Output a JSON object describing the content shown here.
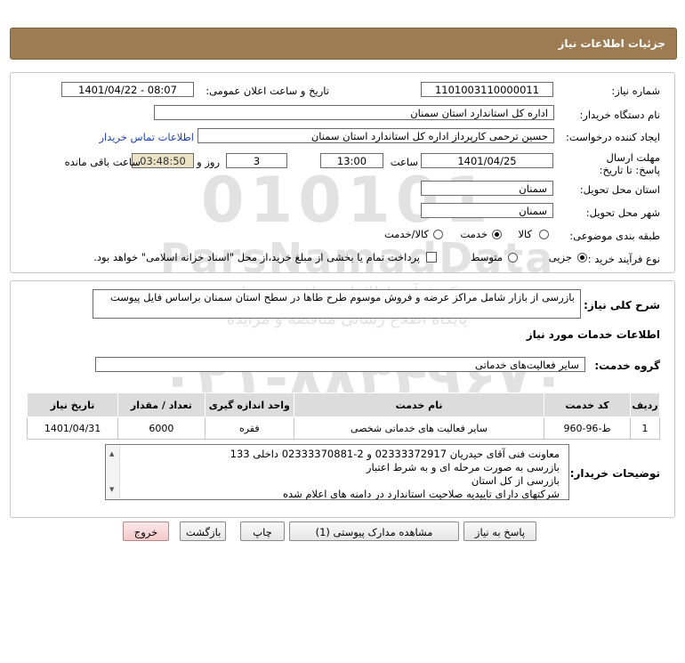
{
  "header": {
    "title": "جزئیات اطلاعات نیاز"
  },
  "watermark": {
    "line1": "010101",
    "line2": "ParsNamadData",
    "line3": "۰۲۱-۸۸۳۴۹۶۷۰",
    "sub1": "مرکز فرآیند اطلاعات مناقصه و مزایده",
    "sub2": "پایگاه اطلاع رسانی مناقصه و مزایده"
  },
  "form": {
    "need_number_label": "شماره نیاز:",
    "need_number": "1101003110000011",
    "announce_label": "تاریخ و ساعت اعلان عمومی:",
    "announce_value": "1401/04/22 - 08:07",
    "buyer_org_label": "نام دستگاه خریدار:",
    "buyer_org": "اداره کل استاندارد استان سمنان",
    "requester_label": "ایجاد کننده درخواست:",
    "requester": "حسین ترحمی کارپرداز اداره کل استاندارد استان سمنان",
    "contact_link": "اطلاعات تماس خریدار",
    "deadline_label": "مهلت ارسال پاسخ: تا تاریخ:",
    "deadline_date": "1401/04/25",
    "time_label": "ساعت",
    "deadline_time": "13:00",
    "days_value": "3",
    "days_label": "روز و",
    "remaining_time": "03:48:50",
    "remaining_label": "ساعت باقی مانده",
    "province_label": "استان محل تحویل:",
    "province": "سمنان",
    "city_label": "شهر محل تحویل:",
    "city": "سمنان",
    "category_label": "طبقه بندی موضوعی:",
    "category_options": [
      "کالا",
      "خدمت",
      "کالا/خدمت"
    ],
    "category_selected": "خدمت",
    "process_label": "نوع فرآیند خرید :",
    "process_options": [
      "جزیی",
      "متوسط"
    ],
    "process_selected": "جزیی",
    "payment_note": "پرداخت تمام یا بخشی از مبلغ خرید،از محل \"اسناد خزانه اسلامی\" خواهد بود."
  },
  "details": {
    "summary_label": "شرح کلی نیاز:",
    "summary": "بازرسی از بازار شامل مراکز عرضه و فروش موسوم طرح طاها در سطح استان سمنان براساس فایل پیوست",
    "services_heading": "اطلاعات خدمات مورد نیاز",
    "service_group_label": "گروه خدمت:",
    "service_group": "سایر فعالیت‌های خدماتی",
    "table": {
      "headers": [
        "ردیف",
        "کد خدمت",
        "نام خدمت",
        "واحد اندازه گیری",
        "تعداد / مقدار",
        "تاریخ نیاز"
      ],
      "rows": [
        [
          "1",
          "ط-96-960",
          "سایر فعالیت های خدماتی شخصی",
          "فقره",
          "6000",
          "1401/04/31"
        ]
      ]
    },
    "buyer_notes_label": "توضیحات خریدار:",
    "buyer_notes": [
      "معاونت فنی آقای حیدریان 02333372917  و 2-02333370881 داخلی 133",
      "بازرسی به صورت مرحله ای و به شرط اعتبار",
      "بازرسی از کل استان",
      "شرکتهای دارای تاییدیه صلاحیت استاندارد در دامنه های اعلام شده"
    ]
  },
  "buttons": {
    "reply": "پاسخ به نیاز",
    "view_docs": "مشاهده مدارک پیوستی (1)",
    "print": "چاپ",
    "back": "بازگشت",
    "exit": "خروج"
  },
  "colors": {
    "title_bg": "#9d7c53",
    "link": "#1a3fb8",
    "remaining_bg": "#ece3c6",
    "exit_bg": "#f3c9c9"
  }
}
